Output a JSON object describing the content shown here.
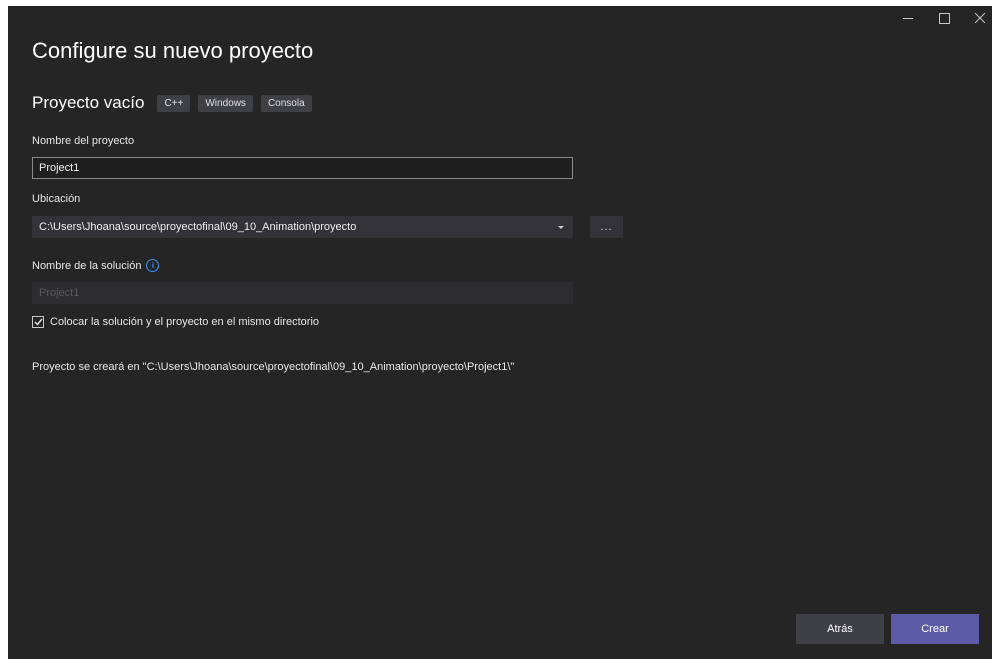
{
  "window_controls": {
    "minimize": "minimize-icon",
    "maximize": "maximize-icon",
    "close": "close-icon"
  },
  "title": "Configure su nuevo proyecto",
  "template": {
    "name": "Proyecto vacío",
    "tags": [
      "C++",
      "Windows",
      "Consola"
    ]
  },
  "project_name": {
    "label": "Nombre del proyecto",
    "value": "Project1"
  },
  "location": {
    "label": "Ubicación",
    "value": "C:\\Users\\Jhoana\\source\\proyectofinal\\09_10_Animation\\proyecto",
    "browse_label": "..."
  },
  "solution_name": {
    "label": "Nombre de la solución",
    "value": "Project1",
    "info_icon": "info-icon"
  },
  "same_directory": {
    "label": "Colocar la solución y el proyecto en el mismo directorio",
    "checked": true
  },
  "path_info": "Proyecto se creará en \"C:\\Users\\Jhoana\\source\\proyectofinal\\09_10_Animation\\proyecto\\Project1\\\"",
  "buttons": {
    "back": "Atrás",
    "create": "Crear"
  },
  "colors": {
    "background": "#252526",
    "primary_button": "#5b5ba8",
    "info_accent": "#3794ff"
  }
}
